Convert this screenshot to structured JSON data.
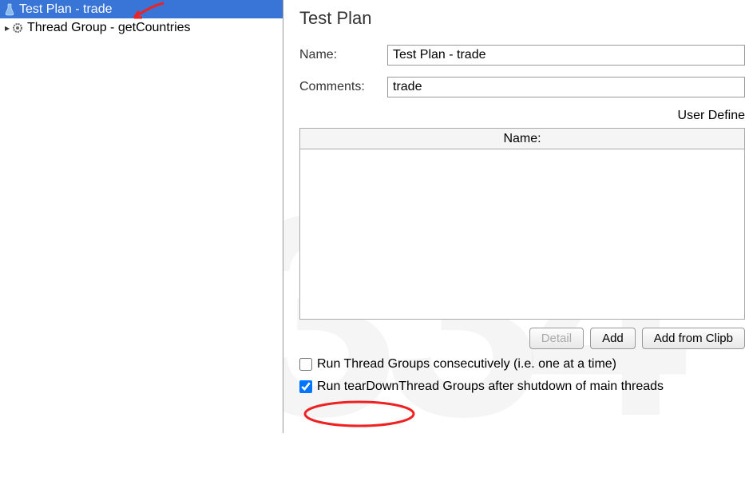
{
  "sidebar": {
    "items": [
      {
        "label": "Test Plan - trade",
        "icon": "flask-icon",
        "selected": true
      },
      {
        "label": "Thread Group - getCountries",
        "icon": "gear-icon",
        "selected": false
      }
    ]
  },
  "panel": {
    "title": "Test Plan",
    "name_label": "Name:",
    "name_value": "Test Plan - trade",
    "comments_label": "Comments:",
    "comments_value": "trade",
    "section_title": "User Define",
    "table": {
      "headers": [
        "Name:"
      ]
    },
    "buttons": {
      "detail": "Detail",
      "add": "Add",
      "add_from_clipboard": "Add from Clipb"
    },
    "checkboxes": {
      "run_consecutive": {
        "checked": false,
        "label": "Run Thread Groups consecutively (i.e. one at a time)"
      },
      "run_teardown": {
        "checked": true,
        "label_part1": "Run tearDown",
        "label_part2": " Thread Groups after shutdown of main threads"
      }
    }
  },
  "watermark": "16334"
}
